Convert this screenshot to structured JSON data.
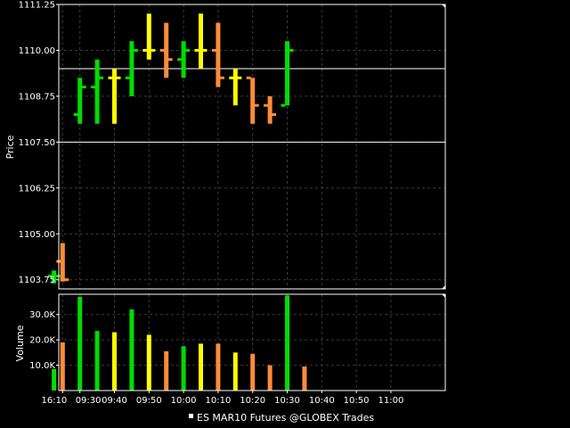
{
  "chart_data": {
    "type": "bar",
    "subtype": "ohlc-bars-with-volume",
    "legend": {
      "marker_color": "#ffffff",
      "label": "ES MAR10 Futures @GLOBEX Trades",
      "placement": "bottom-center"
    },
    "grid": true,
    "colors": {
      "background": "#000000",
      "grid": "#3a3a3a",
      "frame": "#ffffff",
      "green": "#00dd00",
      "yellow": "#ffff00",
      "orange": "#ff8c3a"
    },
    "x_axis": {
      "tick_labels": [
        "16:10",
        "09:30",
        "09:40",
        "09:50",
        "10:00",
        "10:10",
        "10:20",
        "10:30",
        "10:40",
        "10:50",
        "11:00"
      ],
      "tick_slots": [
        -1,
        1,
        5,
        9,
        13,
        17,
        21,
        25,
        29,
        33,
        37
      ]
    },
    "price_panel": {
      "ylabel": "Price",
      "ylim": [
        1103.5,
        1111.25
      ],
      "tick_values": [
        1103.75,
        1105.0,
        1106.25,
        1107.5,
        1108.75,
        1110.0,
        1111.25
      ],
      "tick_labels": [
        "1103.75",
        "1105.00",
        "1106.25",
        "1107.50",
        "1108.75",
        "1110.00",
        "1111.25"
      ],
      "reference_lines": [
        1109.5,
        1107.5
      ]
    },
    "volume_panel": {
      "ylabel": "Volume",
      "ylim": [
        0,
        38000
      ],
      "tick_values": [
        10000,
        20000,
        30000
      ],
      "tick_labels": [
        "10.0K",
        "20.0K",
        "30.0K"
      ]
    },
    "bars": [
      {
        "slot": -2,
        "high": 1104.0,
        "low": 1103.65,
        "open": 1103.85,
        "close": 1103.85,
        "color": "green",
        "volume": 8500
      },
      {
        "slot": -1,
        "high": 1104.75,
        "low": 1103.7,
        "open": 1104.25,
        "close": 1103.75,
        "color": "orange",
        "volume": 19000
      },
      {
        "slot": 1,
        "high": 1109.25,
        "low": 1108.0,
        "open": 1108.25,
        "close": 1109.0,
        "color": "green",
        "volume": 37000
      },
      {
        "slot": 3,
        "high": 1109.75,
        "low": 1108.0,
        "open": 1109.0,
        "close": 1109.25,
        "color": "green",
        "volume": 23500
      },
      {
        "slot": 5,
        "high": 1109.5,
        "low": 1108.0,
        "open": 1109.25,
        "close": 1109.25,
        "color": "yellow",
        "volume": 23000
      },
      {
        "slot": 7,
        "high": 1110.25,
        "low": 1108.75,
        "open": 1109.25,
        "close": 1110.0,
        "color": "green",
        "volume": 32000
      },
      {
        "slot": 9,
        "high": 1111.0,
        "low": 1109.75,
        "open": 1110.0,
        "close": 1110.0,
        "color": "yellow",
        "volume": 22000
      },
      {
        "slot": 11,
        "high": 1110.75,
        "low": 1109.25,
        "open": 1110.0,
        "close": 1109.75,
        "color": "orange",
        "volume": 15500
      },
      {
        "slot": 13,
        "high": 1110.25,
        "low": 1109.25,
        "open": 1109.75,
        "close": 1110.0,
        "color": "green",
        "volume": 17500
      },
      {
        "slot": 15,
        "high": 1111.0,
        "low": 1109.5,
        "open": 1110.0,
        "close": 1110.0,
        "color": "yellow",
        "volume": 18500
      },
      {
        "slot": 17,
        "high": 1110.75,
        "low": 1109.0,
        "open": 1110.0,
        "close": 1109.25,
        "color": "orange",
        "volume": 18500
      },
      {
        "slot": 19,
        "high": 1109.5,
        "low": 1108.5,
        "open": 1109.25,
        "close": 1109.25,
        "color": "yellow",
        "volume": 15000
      },
      {
        "slot": 21,
        "high": 1109.25,
        "low": 1108.0,
        "open": 1109.25,
        "close": 1108.5,
        "color": "orange",
        "volume": 14500
      },
      {
        "slot": 23,
        "high": 1108.75,
        "low": 1108.0,
        "open": 1108.5,
        "close": 1108.25,
        "color": "orange",
        "volume": 10000
      },
      {
        "slot": 25,
        "high": 1110.25,
        "low": 1108.5,
        "open": 1108.5,
        "close": 1110.0,
        "color": "green",
        "volume": 37500
      },
      {
        "slot": 27,
        "high": null,
        "low": null,
        "open": null,
        "close": null,
        "color": "orange",
        "volume": 9500
      }
    ]
  }
}
